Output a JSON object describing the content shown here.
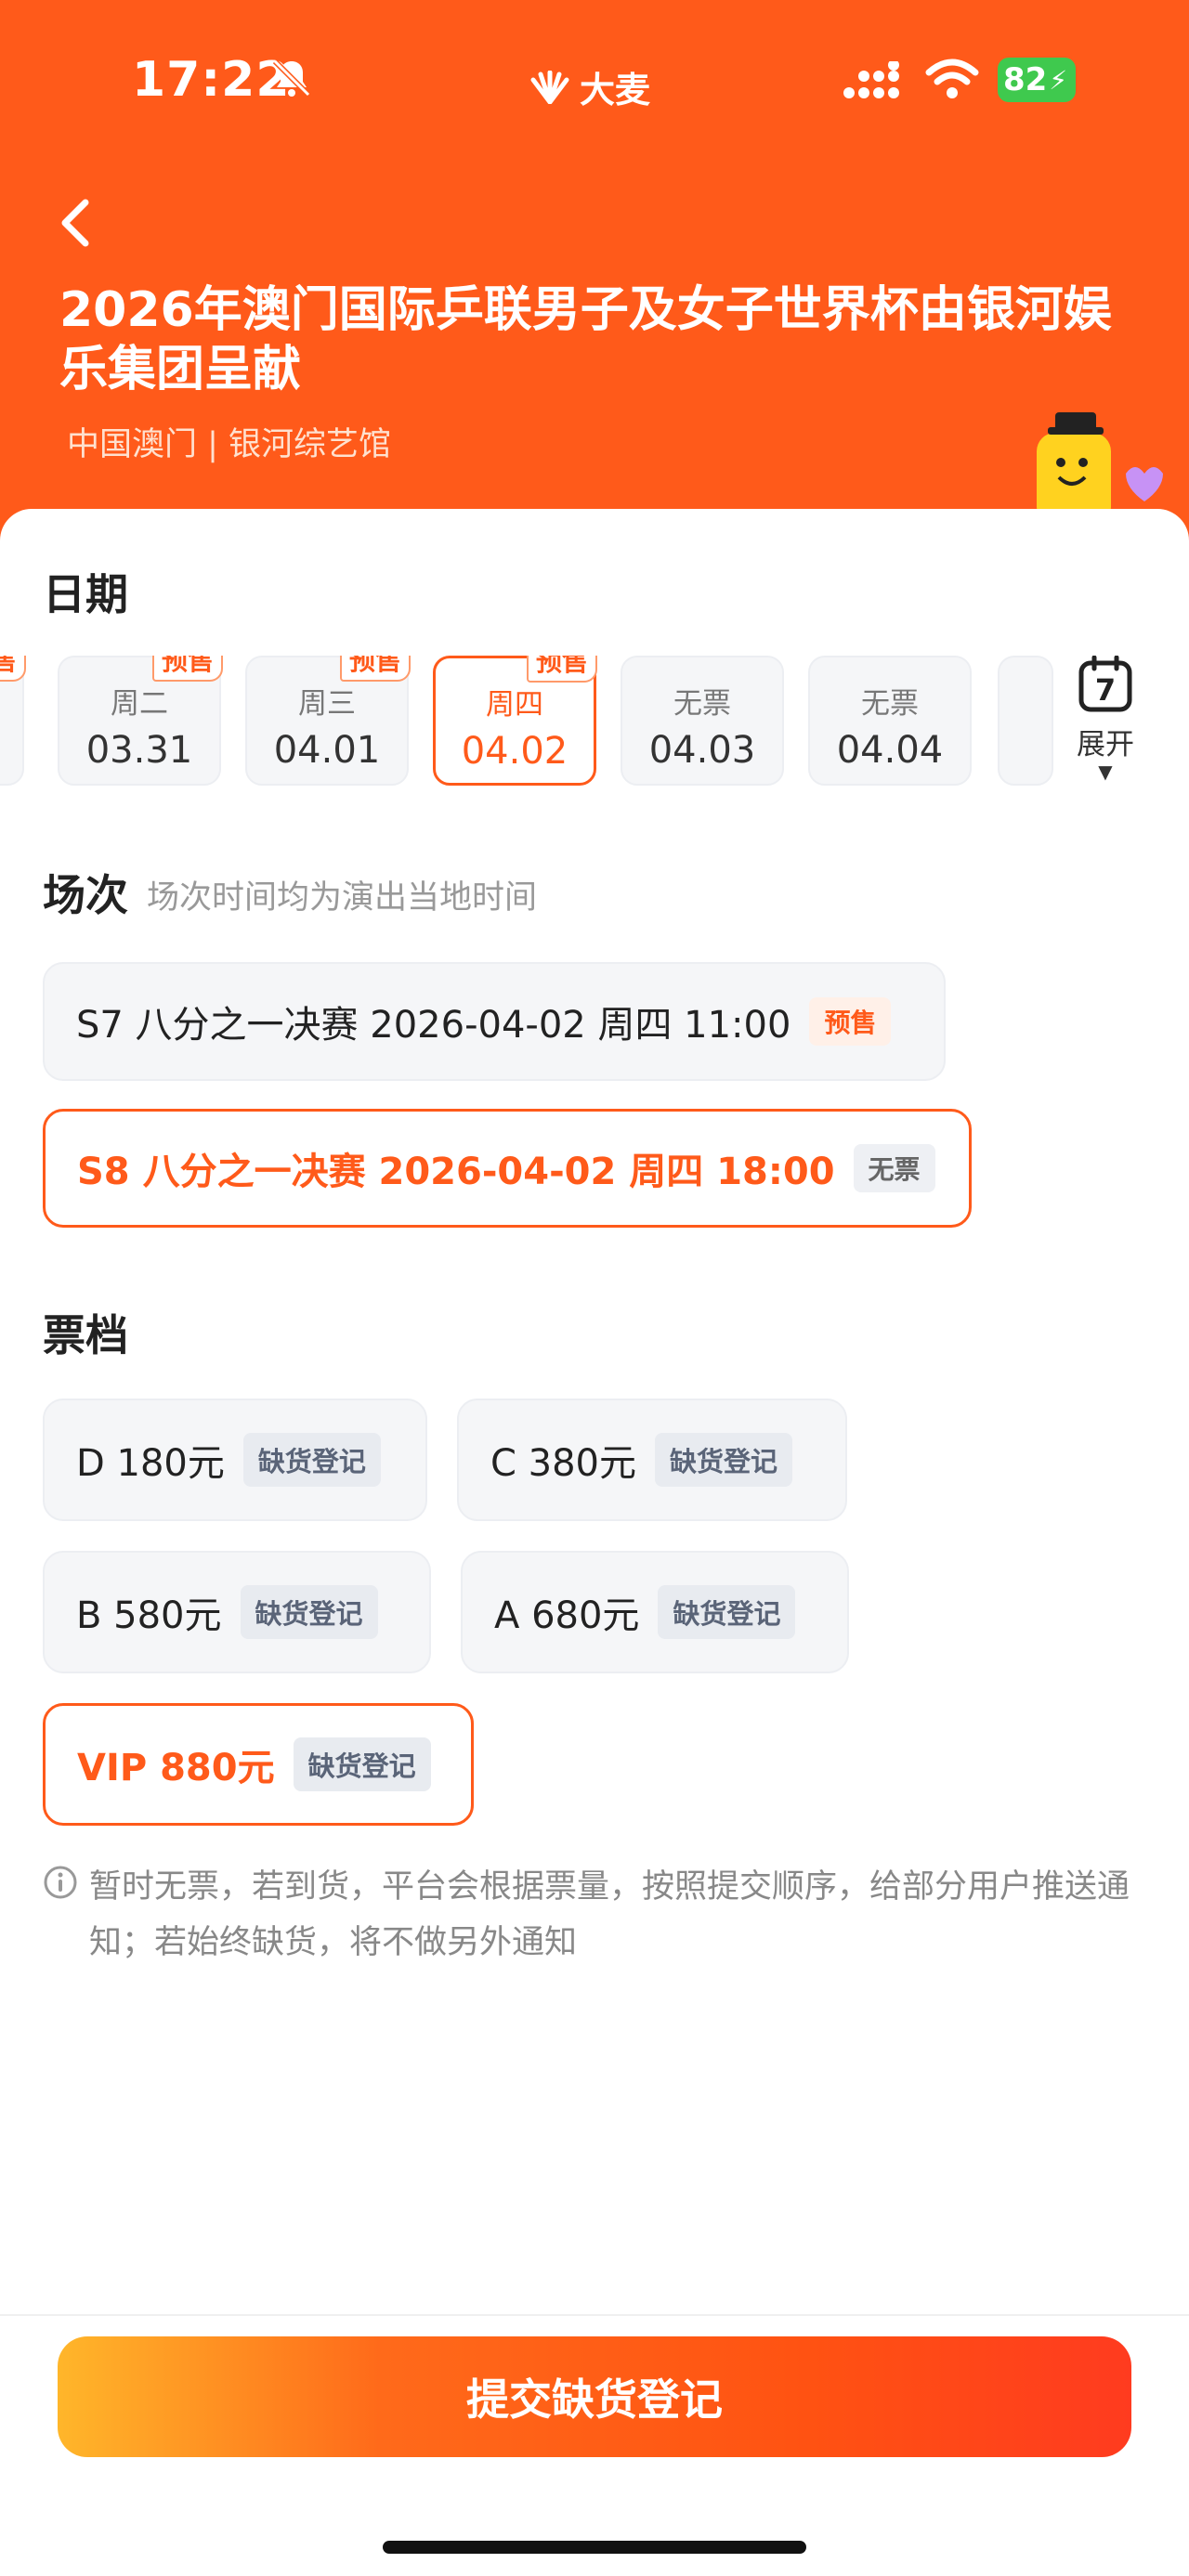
{
  "status": {
    "time": "17:22",
    "battery": "82",
    "logo_text": "大麦"
  },
  "header": {
    "title": "2026年澳门国际乒联男子及女子世界杯由银河娱乐集团呈献",
    "venue": "中国澳门 | 银河综艺馆"
  },
  "date_section": {
    "title": "日期",
    "partial_left_tag": "售",
    "dates": [
      {
        "weekday": "周二",
        "date": "03.31",
        "tag": "预售"
      },
      {
        "weekday": "周三",
        "date": "04.01",
        "tag": "预售"
      },
      {
        "weekday": "周四",
        "date": "04.02",
        "tag": "预售",
        "selected": true
      },
      {
        "weekday": "无票",
        "date": "04.03",
        "tag": ""
      },
      {
        "weekday": "无票",
        "date": "04.04",
        "tag": ""
      }
    ],
    "expand_label": "展开",
    "calendar_number": "7"
  },
  "session_section": {
    "title": "场次",
    "subtitle": "场次时间均为演出当地时间",
    "sessions": [
      {
        "label": "S7 八分之一决赛 2026-04-02 周四 11:00",
        "tag": "预售"
      },
      {
        "label": "S8 八分之一决赛 2026-04-02 周四 18:00",
        "tag": "无票",
        "selected": true
      }
    ]
  },
  "tier_section": {
    "title": "票档",
    "tiers": [
      {
        "label": "D 180元",
        "badge": "缺货登记"
      },
      {
        "label": "C 380元",
        "badge": "缺货登记"
      },
      {
        "label": "B 580元",
        "badge": "缺货登记"
      },
      {
        "label": "A 680元",
        "badge": "缺货登记"
      },
      {
        "label": "VIP 880元",
        "badge": "缺货登记",
        "selected": true
      }
    ]
  },
  "notice": "暂时无票，若到货，平台会根据票量，按照提交顺序，给部分用户推送通知；若始终缺货，将不做另外通知",
  "submit_label": "提交缺货登记",
  "colors": {
    "brand": "#ff5a1a",
    "sheet": "#ffffff",
    "card": "#f5f6f8"
  }
}
